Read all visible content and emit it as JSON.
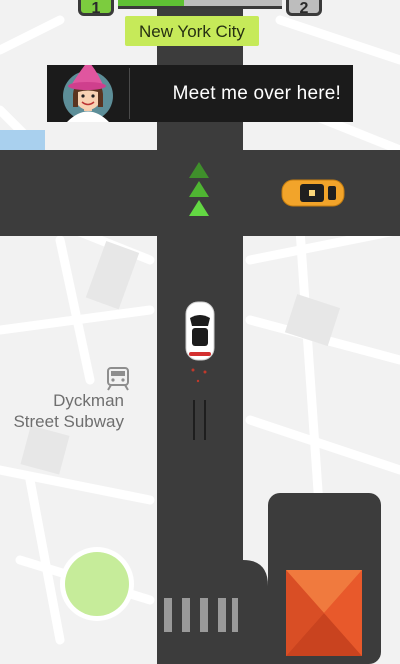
{
  "level": {
    "current": "1",
    "next": "2",
    "progress": 0.4
  },
  "location": {
    "city": "New York City"
  },
  "dialog": {
    "message": "Meet me over here!",
    "speaker_icon": "girl-with-pink-hat-avatar"
  },
  "map": {
    "poi": {
      "icon": "train-icon",
      "name_line1": "Dyckman",
      "name_line2": "Street Subway"
    }
  },
  "colors": {
    "road": "#3c3c3c",
    "map_background": "#f2f2f2",
    "level_fill": "#5fc034",
    "city_badge": "#c6ea59",
    "direction_arrows": "#63d843",
    "taxi": "#f2a42a",
    "destination_roof": "#e8592b",
    "pickup_circle": "#c6ec9a"
  }
}
